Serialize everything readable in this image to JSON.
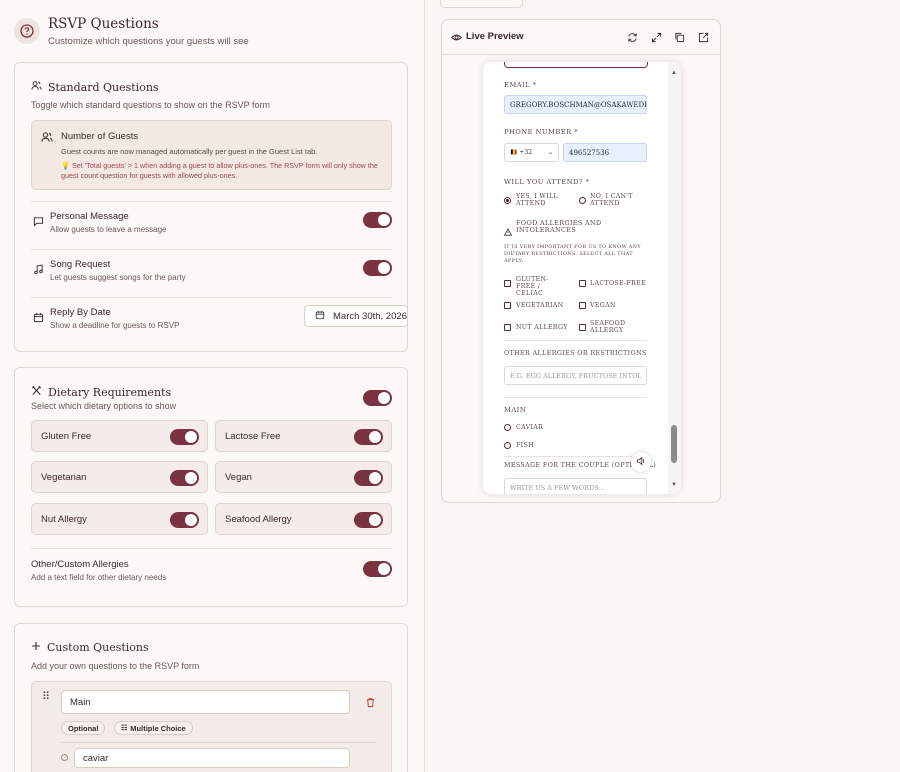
{
  "header": {
    "title": "RSVP Questions",
    "subtitle": "Customize which questions your guests will see",
    "icon": "question-circle-icon"
  },
  "standard": {
    "title": "Standard Questions",
    "subtitle": "Toggle which standard questions to show on the RSVP form",
    "guests": {
      "title": "Number of Guests",
      "desc": "Guest counts are now managed automatically per guest in the Guest List tab.",
      "tip": "💡 Set 'Total guests' > 1 when adding a guest to allow plus-ones. The RSVP form will only show the guest count question for guests with allowed plus-ones."
    },
    "items": [
      {
        "title": "Personal Message",
        "sub": "Allow guests to leave a message",
        "on": true
      },
      {
        "title": "Song Request",
        "sub": "Let guests suggest songs for the party",
        "on": true
      },
      {
        "title": "Reply By Date",
        "sub": "Show a deadline for guests to RSVP",
        "date": "March 30th, 2026"
      }
    ]
  },
  "dietary": {
    "title": "Dietary Requirements",
    "subtitle": "Select which dietary options to show",
    "options": [
      "Gluten Free",
      "Lactose Free",
      "Vegetarian",
      "Vegan",
      "Nut Allergy",
      "Seafood Allergy"
    ],
    "other": {
      "title": "Other/Custom Allergies",
      "sub": "Add a text field for other dietary needs"
    }
  },
  "custom": {
    "title": "Custom Questions",
    "subtitle": "Add your own questions to the RSVP form",
    "question": {
      "value": "Main",
      "tag_optional": "Optional",
      "tag_type": "Multiple Choice",
      "option1": "caviar"
    }
  },
  "preview": {
    "title": "Live Preview",
    "email_label": "EMAIL *",
    "email_value": "GREGORY.BOSCHMAN@OSAKAWEDD",
    "phone_label": "PHONE NUMBER *",
    "phone_code": "🇧🇪 +32",
    "phone_value": "496527536",
    "attend_label": "WILL YOU ATTEND? *",
    "attend_yes": "YES, I WILL ATTEND",
    "attend_no": "NO, I CAN'T ATTEND",
    "allergy_title": "FOOD ALLERGIES AND INTOLERANCES",
    "allergy_desc": "IT IS VERY IMPORTANT FOR US TO KNOW ANY DIETARY RESTRICTIONS. SELECT ALL THAT APPLY:",
    "allergy_opts": [
      "GLUTEN-FREE / CELIAC",
      "LACTOSE-FREE",
      "VEGETARIAN",
      "VEGAN",
      "NUT ALLERGY",
      "SEAFOOD ALLERGY"
    ],
    "other_label": "OTHER ALLERGIES OR RESTRICTIONS",
    "other_placeholder": "E.G. EGG ALLERGY, FRUCTOSE INTOL",
    "main_label": "MAIN",
    "main_opts": [
      "CAVIAR",
      "FISH"
    ],
    "message_label": "MESSAGE FOR THE COUPLE (OPTIONAL)",
    "message_placeholder": "WRITE US A FEW WORDS..."
  },
  "colors": {
    "accent": "#7a3340",
    "background": "#f9f5f2"
  }
}
